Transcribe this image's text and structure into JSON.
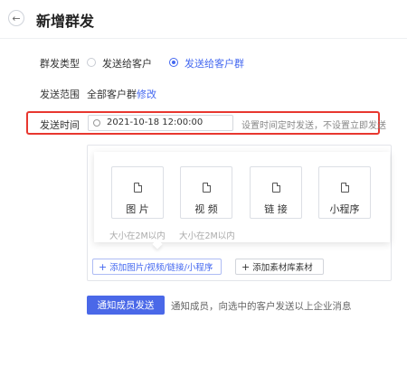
{
  "header": {
    "title": "新增群发",
    "back_icon": "arrow-left-icon"
  },
  "form": {
    "type_label": "群发类型",
    "type_options": [
      {
        "label": "发送给客户",
        "checked": false
      },
      {
        "label": "发送给客户群",
        "checked": true
      }
    ],
    "range_label": "发送范围",
    "range_value": "全部客户群",
    "range_edit": "修改",
    "time_label": "发送时间",
    "time_value": "2021-10-18 12:00:00",
    "time_hint": "设置时间定时发送，不设置立即发送"
  },
  "materials": {
    "cards": [
      {
        "label": "图 片",
        "icon": "image-file-icon"
      },
      {
        "label": "视 频",
        "icon": "video-file-icon"
      },
      {
        "label": "链 接",
        "icon": "link-file-icon"
      },
      {
        "label": "小程序",
        "icon": "mini-program-file-icon"
      }
    ],
    "size_note": "大小在2M以内",
    "add_content": "添加图片/视频/链接/小程序",
    "add_library": "添加素材库素材"
  },
  "actions": {
    "notify": "通知成员发送",
    "notify_desc": "通知成员，向选中的客户发送以上企业消息"
  },
  "colors": {
    "accent": "#4468f0",
    "highlight": "#e8372f"
  }
}
